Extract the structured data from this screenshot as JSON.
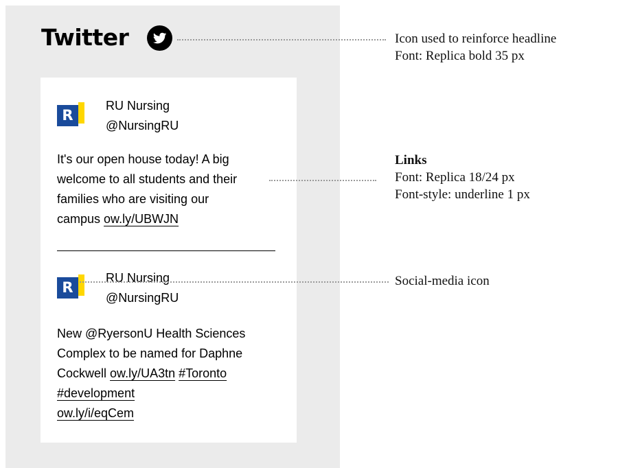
{
  "headline": {
    "text": "Twitter",
    "icon": "twitter-bird-icon"
  },
  "colors": {
    "panel_bg": "#ebebeb",
    "logo_blue": "#1a4b9b",
    "logo_yellow": "#ffd700"
  },
  "tweets": [
    {
      "logo_letter": "R",
      "name": "RU Nursing",
      "handle": "@NursingRU",
      "lines": [
        "It's our open house today! A big",
        "welcome to all students and their",
        "families who are visiting our"
      ],
      "last_line_text": "campus",
      "links": [
        "ow.ly/UBWJN"
      ]
    },
    {
      "logo_letter": "R",
      "name": "RU Nursing",
      "handle": "@NursingRU",
      "lines": [
        "New @RyersonU Health Sciences",
        "Complex to be named for Daphne"
      ],
      "mixed_line_text": "Cockwell",
      "links": [
        "ow.ly/UA3tn",
        "#Toronto",
        "#development",
        "ow.ly/i/eqCem"
      ]
    }
  ],
  "annotations": {
    "icon_note": {
      "line1": "Icon used to reinforce headline",
      "line2": "Font: Replica bold 35 px"
    },
    "links_note": {
      "title": "Links",
      "line1": "Font: Replica 18/24 px",
      "line2": "Font-style: underline 1 px"
    },
    "social_note": {
      "line1": "Social-media icon"
    }
  }
}
